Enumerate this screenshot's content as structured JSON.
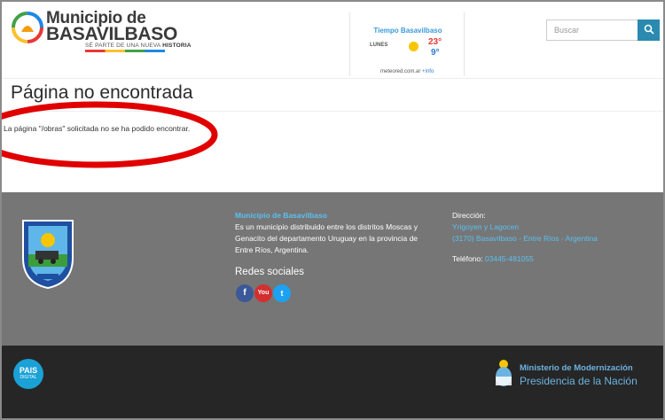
{
  "header": {
    "logo": {
      "line1": "Municipio de",
      "line2": "BASAVILBASO",
      "tagline_pre": "SÉ PARTE DE UNA NUEVA",
      "tagline_bold": "HISTORIA"
    },
    "weather": {
      "title": "Tiempo Basavilbaso",
      "day": "LUNES",
      "temp_max": "23°",
      "temp_min": "9°",
      "source": "meteored.com.ar",
      "info_link": "+info"
    },
    "search": {
      "placeholder": "Buscar",
      "button_icon": "search-icon"
    }
  },
  "main": {
    "title": "Página no encontrada",
    "message": "La página \"/obras\" solicitada no se ha podido encontrar."
  },
  "footer": {
    "org_name": "Municipio de Basavilbaso",
    "description": "Es un municipio distribuido entre los distritos Moscas y Genacito del departamento Uruguay en la provincia de Entre Ríos, Argentina.",
    "social_title": "Redes sociales",
    "social": [
      {
        "icon": "facebook-icon",
        "glyph": "f"
      },
      {
        "icon": "youtube-icon",
        "glyph": "You"
      },
      {
        "icon": "twitter-icon",
        "glyph": "t"
      }
    ],
    "address_label": "Dirección:",
    "address_line1": "Yrigoyen y Lagocen",
    "address_line2": "(3170) Basavilbaso - Entre Ríos - Argentina",
    "phone_label": "Teléfono:",
    "phone_number": "03445-481055"
  },
  "bottom": {
    "pais_line1": "PAIS",
    "pais_line2": "DIGITAL",
    "ministry_line1": "Ministerio de Modernización",
    "ministry_line2": "Presidencia de la Nación"
  },
  "colors": {
    "accent": "#2a8ab0",
    "link": "#5bc0f0",
    "footer_bg": "#767676",
    "bottom_bg": "#262626",
    "highlight": "#e00000"
  }
}
